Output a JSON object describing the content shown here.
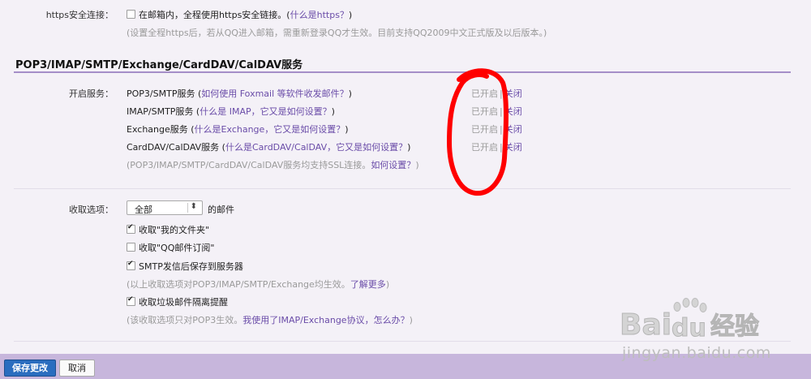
{
  "https": {
    "label": "https安全连接：",
    "option": "在邮箱内，全程使用https安全链接。(",
    "link": "什么是https？",
    "close": ")",
    "hint": "(设置全程https后，若从QQ进入邮箱，需重新登录QQ才生效。目前支持QQ2009中文正式版及以后版本。)"
  },
  "section": {
    "title": "POP3/IMAP/SMTP/Exchange/CardDAV/CalDAV服务"
  },
  "services": {
    "label": "开启服务：",
    "items": [
      {
        "name": "POP3/SMTP服务 (",
        "link": "如何使用 Foxmail 等软件收发邮件？",
        "close": ")",
        "on": "已开启",
        "sep": "|",
        "off": "关闭"
      },
      {
        "name": "IMAP/SMTP服务 (",
        "link": "什么是 IMAP，它又是如何设置？",
        "close": ")",
        "on": "已开启",
        "sep": "|",
        "off": "关闭"
      },
      {
        "name": "Exchange服务 (",
        "link": "什么是Exchange，它又是如何设置？",
        "close": ")",
        "on": "已开启",
        "sep": "|",
        "off": "关闭"
      },
      {
        "name": "CardDAV/CalDAV服务 (",
        "link": "什么是CardDAV/CalDAV，它又是如何设置？",
        "close": ")",
        "on": "已开启",
        "sep": "|",
        "off": "关闭"
      }
    ],
    "ssl_hint": "(POP3/IMAP/SMTP/CardDAV/CalDAV服务均支持SSL连接。",
    "ssl_link": "如何设置？",
    "ssl_close": ")"
  },
  "receive": {
    "label": "收取选项：",
    "select_value": "全部",
    "select_arrow": "⬍",
    "suffix": "的邮件",
    "options": [
      {
        "text": "收取\"我的文件夹\"",
        "checked": true
      },
      {
        "text": "收取\"QQ邮件订阅\"",
        "checked": false
      },
      {
        "text": "SMTP发信后保存到服务器",
        "checked": true
      }
    ],
    "hint1": "(以上收取选项对POP3/IMAP/SMTP/Exchange均生效。",
    "hint1_link": "了解更多",
    "hint1_close": ")",
    "spam": {
      "text": "收取垃圾邮件隔离提醒",
      "checked": true
    },
    "hint2": "(该收取选项只对POP3生效。",
    "hint2_link": "我使用了IMAP/Exchange协议，怎么办？",
    "hint2_close": ")"
  },
  "footer": {
    "save": "保存更改",
    "cancel": "取消"
  },
  "watermark": {
    "logo": "Bai du 经验",
    "url": "jingyan.baidu.com"
  },
  "colors": {
    "accent": "#6a4ca8",
    "footer": "#c7b6dc",
    "save": "#2a6dbf",
    "annotation": "#ff0000"
  }
}
